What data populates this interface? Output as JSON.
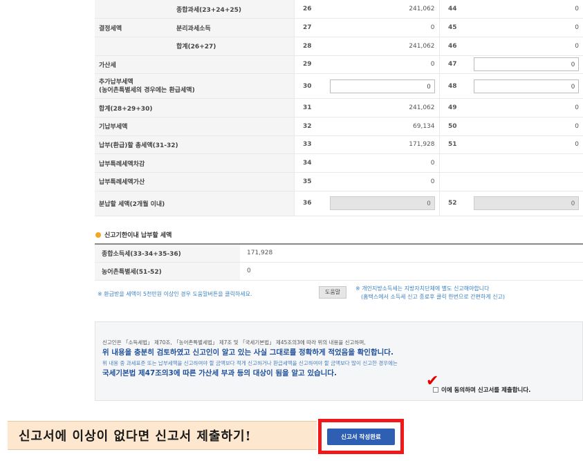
{
  "tax_rows": [
    {
      "head": "",
      "sub": "종합과세(23+24+25)",
      "no": "26",
      "amount": "241,062",
      "no2": "44",
      "amount2": "0"
    },
    {
      "head": "결정세액",
      "sub": "분리과세소득",
      "no": "27",
      "amount": "0",
      "no2": "45",
      "amount2": "0"
    },
    {
      "head": "",
      "sub": "합계(26+27)",
      "no": "28",
      "amount": "241,062",
      "no2": "46",
      "amount2": "0"
    },
    {
      "head": "가산세",
      "sub": "",
      "no": "29",
      "amount": "0",
      "no2": "47",
      "amount2": "0"
    },
    {
      "head": "추가납부세액\n(농어촌특별세의 경우에는 환급세액)",
      "sub": "",
      "no": "30",
      "amount": "0",
      "no2": "48",
      "amount2": "0"
    },
    {
      "head": "합계(28+29+30)",
      "sub": "",
      "no": "31",
      "amount": "241,062",
      "no2": "49",
      "amount2": "0"
    },
    {
      "head": "기납부세액",
      "sub": "",
      "no": "32",
      "amount": "69,134",
      "no2": "50",
      "amount2": "0"
    },
    {
      "head": "납부(환급)할 총세액(31-32)",
      "sub": "",
      "no": "33",
      "amount": "171,928",
      "no2": "51",
      "amount2": "0"
    },
    {
      "head": "납부특례세액차감",
      "sub": "",
      "no": "34",
      "amount": "0",
      "no2": "",
      "amount2": ""
    },
    {
      "head": "납부특례세액가산",
      "sub": "",
      "no": "35",
      "amount": "0",
      "no2": "",
      "amount2": ""
    },
    {
      "head": "분납할 세액(2개월 이내)",
      "sub": "",
      "no": "36",
      "amount": "0",
      "no2": "52",
      "amount2": "0"
    }
  ],
  "section": {
    "title": "신고기한이내 납부할 세액",
    "rows": [
      {
        "label": "종합소득세(33-34+35-36)",
        "value": "171,928"
      },
      {
        "label": "농어촌특별세(51-52)",
        "value": "0"
      }
    ]
  },
  "notes": {
    "left": "※ 환급받을 세액이 5천만원 이상인 경우 도움말버튼을 클릭하세요.",
    "help_button": "도움말",
    "right_line1": "※ 개인지방소득세는 지방자치단체에 별도 신고해야합니다",
    "right_line2": "(홈택스에서 소득세 신고 종료후 클릭 한번으로 간편하게 신고)"
  },
  "agreement": {
    "line1": "신고인은 「소득세법」 제70조, 「농어촌특별세법」 제7조 및 「국세기본법」 제45조의3에 따라 위의 내용을 신고하며,",
    "line2": "위 내용을 충분히 검토하였고 신고인이 알고 있는 사실 그대로를 정확하게 적었음을 확인합니다.",
    "line3": "위 내용 중 과세표준 또는 납부세액을 신고하여야 할 금액보다 적게 신고하거나 환급세액을 신고하여야 할 금액보다 많이 신고한 경우에는",
    "line4": "국세기본법 제47조의3에 따른 가산세 부과 등의 대상이 됨을 알고 있습니다.",
    "checkbox_label": "이에 동의하며 신고서를 제출합니다."
  },
  "banner_text": "신고서에 이상이 없다면 신고서 제출하기!",
  "submit_label": "신고서 작성완료",
  "colors": {
    "highlight": "#f01818",
    "primary_button": "#2f5fb3",
    "banner_bg": "#fde7cf"
  }
}
